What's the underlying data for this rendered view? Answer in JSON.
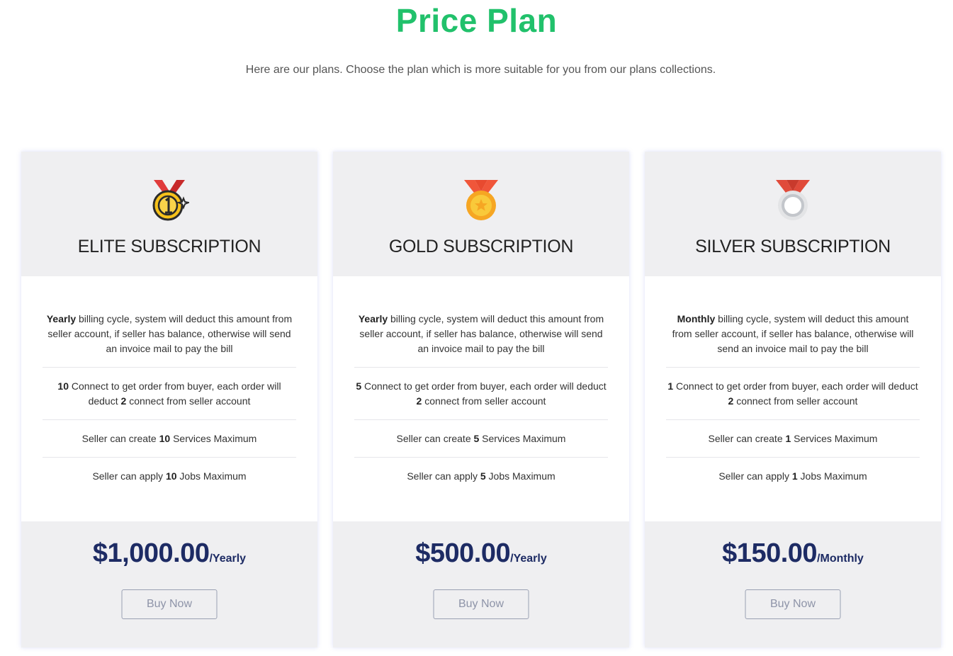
{
  "header": {
    "title": "Price Plan",
    "subtitle": "Here are our plans. Choose the plan which is more suitable for you from our plans collections."
  },
  "plans": [
    {
      "icon": "elite-medal-icon",
      "name": "ELITE SUBSCRIPTION",
      "features": [
        {
          "bold": "Yearly",
          "text": " billing cycle, system will deduct this amount from seller account, if seller has balance, otherwise will send an invoice mail to pay the bill"
        },
        {
          "bold": "10",
          "text": " Connect to get order from buyer, each order will deduct ",
          "bold2": "2",
          "text2": " connect from seller account"
        },
        {
          "pre": "Seller can create ",
          "bold": "10",
          "text": " Services Maximum"
        },
        {
          "pre": "Seller can apply ",
          "bold": "10",
          "text": " Jobs Maximum"
        }
      ],
      "price": "$1,000.00",
      "period": "/Yearly",
      "button": "Buy Now"
    },
    {
      "icon": "gold-medal-icon",
      "name": "GOLD SUBSCRIPTION",
      "features": [
        {
          "bold": "Yearly",
          "text": " billing cycle, system will deduct this amount from seller account, if seller has balance, otherwise will send an invoice mail to pay the bill"
        },
        {
          "bold": "5",
          "text": " Connect to get order from buyer, each order will deduct ",
          "bold2": "2",
          "text2": " connect from seller account"
        },
        {
          "pre": "Seller can create ",
          "bold": "5",
          "text": " Services Maximum"
        },
        {
          "pre": "Seller can apply ",
          "bold": "5",
          "text": " Jobs Maximum"
        }
      ],
      "price": "$500.00",
      "period": "/Yearly",
      "button": "Buy Now"
    },
    {
      "icon": "silver-medal-icon",
      "name": "SILVER SUBSCRIPTION",
      "features": [
        {
          "bold": "Monthly",
          "text": " billing cycle, system will deduct this amount from seller account, if seller has balance, otherwise will send an invoice mail to pay the bill"
        },
        {
          "bold": "1",
          "text": " Connect to get order from buyer, each order will deduct ",
          "bold2": "2",
          "text2": " connect from seller account"
        },
        {
          "pre": "Seller can create ",
          "bold": "1",
          "text": " Services Maximum"
        },
        {
          "pre": "Seller can apply ",
          "bold": "1",
          "text": " Jobs Maximum"
        }
      ],
      "price": "$150.00",
      "period": "/Monthly",
      "button": "Buy Now"
    }
  ],
  "colors": {
    "title_green": "#21c16b",
    "price_navy": "#1d2b64",
    "card_gray": "#efeff1"
  }
}
